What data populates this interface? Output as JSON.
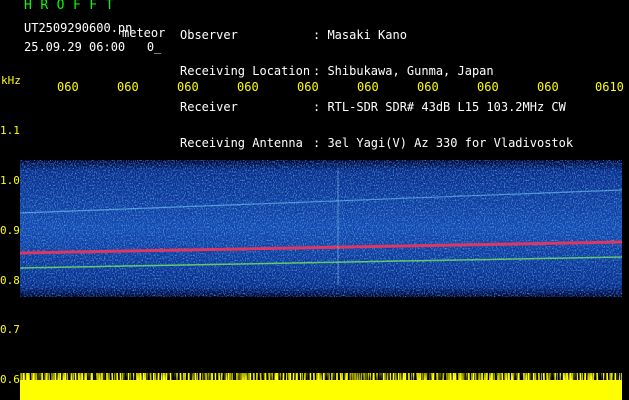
{
  "header": {
    "app_title": "HROFFT",
    "filename": "UT2509290600.pn",
    "meteor_label": "meteor",
    "datetime": "25.09.29 06:00   0_",
    "params": [
      {
        "label": "Observer",
        "value": ": Masaki Kano"
      },
      {
        "label": "Receiving Location",
        "value": ": Shibukawa, Gunma, Japan"
      },
      {
        "label": "Receiver",
        "value": ": RTL-SDR SDR# 43dB L15 103.2MHz CW"
      },
      {
        "label": "Receiving Antenna",
        "value": ": 3el Yagi(V) Az 330 for Vladivostok"
      }
    ]
  },
  "time_axis": {
    "labels": [
      "060",
      "060",
      "060",
      "060",
      "060",
      "060",
      "060",
      "060",
      "060",
      "0610"
    ]
  },
  "freq_axis": {
    "unit": "kHz",
    "labels": [
      "1.1",
      "1.0",
      "0.9",
      "0.8",
      "0.7",
      "0.6"
    ]
  },
  "colors": {
    "text_header": "#ffffff",
    "text_axis": "#ffff00",
    "title": "#00ff00",
    "spectrum_bg": "#0a1a6e",
    "signal": "#ff3355",
    "power": "#ffff00"
  }
}
